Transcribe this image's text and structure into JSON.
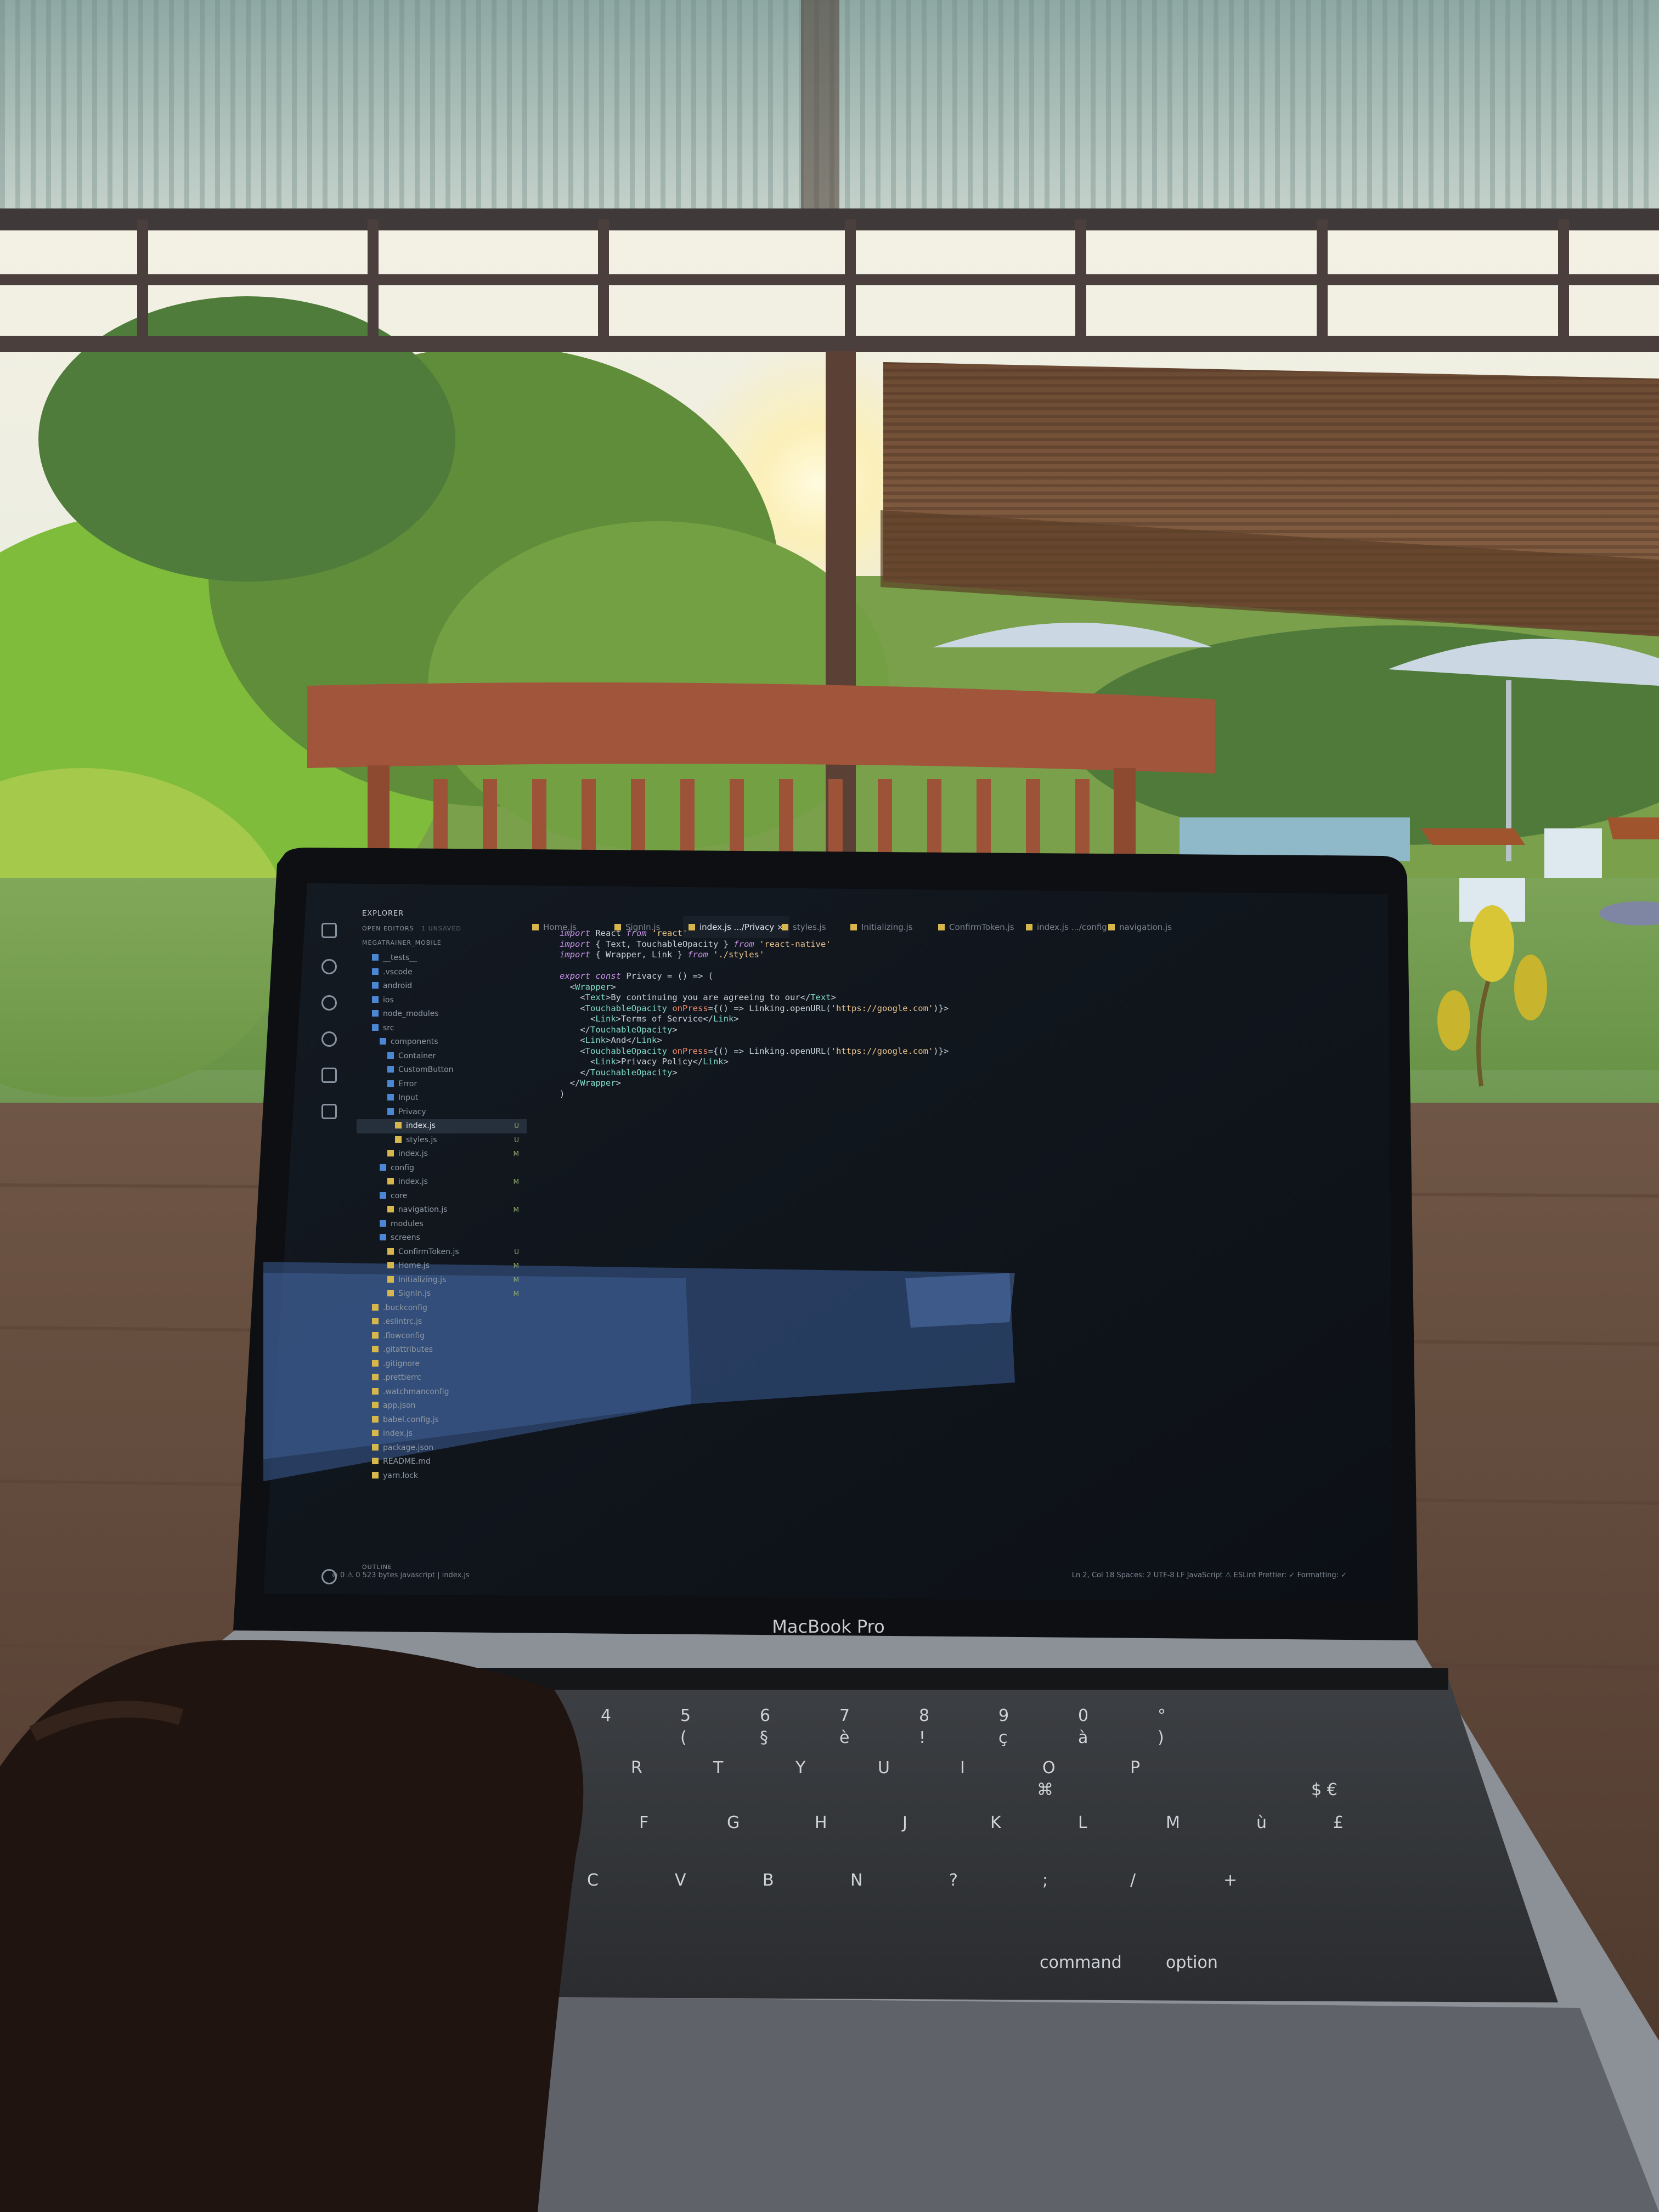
{
  "screen": {
    "explorer": {
      "title": "EXPLORER",
      "open_editors": "OPEN EDITORS",
      "open_editors_badge": "1 UNSAVED",
      "project": "MEGATRAINER_MOBILE",
      "outline": "OUTLINE",
      "tree": [
        {
          "label": "__tests__",
          "kind": "folder",
          "indent": 2
        },
        {
          "label": ".vscode",
          "kind": "folder",
          "indent": 2
        },
        {
          "label": "android",
          "kind": "folder",
          "indent": 2
        },
        {
          "label": "ios",
          "kind": "folder",
          "indent": 2
        },
        {
          "label": "node_modules",
          "kind": "folder",
          "indent": 2
        },
        {
          "label": "src",
          "kind": "folder",
          "indent": 2
        },
        {
          "label": "components",
          "kind": "folder",
          "indent": 3
        },
        {
          "label": "Container",
          "kind": "folder",
          "indent": 4
        },
        {
          "label": "CustomButton",
          "kind": "folder",
          "indent": 4
        },
        {
          "label": "Error",
          "kind": "folder",
          "indent": 4
        },
        {
          "label": "Input",
          "kind": "folder",
          "indent": 4
        },
        {
          "label": "Privacy",
          "kind": "folder",
          "indent": 4
        },
        {
          "label": "index.js",
          "kind": "file",
          "indent": 5,
          "status": "U",
          "active": true
        },
        {
          "label": "styles.js",
          "kind": "file",
          "indent": 5,
          "status": "U"
        },
        {
          "label": "index.js",
          "kind": "file",
          "indent": 4,
          "status": "M"
        },
        {
          "label": "config",
          "kind": "folder",
          "indent": 3
        },
        {
          "label": "index.js",
          "kind": "file",
          "indent": 4,
          "status": "M"
        },
        {
          "label": "core",
          "kind": "folder",
          "indent": 3
        },
        {
          "label": "navigation.js",
          "kind": "file",
          "indent": 4,
          "status": "M"
        },
        {
          "label": "modules",
          "kind": "folder",
          "indent": 3
        },
        {
          "label": "screens",
          "kind": "folder",
          "indent": 3
        },
        {
          "label": "ConfirmToken.js",
          "kind": "file",
          "indent": 4,
          "status": "U"
        },
        {
          "label": "Home.js",
          "kind": "file",
          "indent": 4,
          "status": "M"
        },
        {
          "label": "Initializing.js",
          "kind": "file",
          "indent": 4,
          "status": "M"
        },
        {
          "label": "SignIn.js",
          "kind": "file",
          "indent": 4,
          "status": "M"
        },
        {
          "label": ".buckconfig",
          "kind": "file",
          "indent": 2
        },
        {
          "label": ".eslintrc.js",
          "kind": "file",
          "indent": 2
        },
        {
          "label": ".flowconfig",
          "kind": "file",
          "indent": 2
        },
        {
          "label": ".gitattributes",
          "kind": "file",
          "indent": 2
        },
        {
          "label": ".gitignore",
          "kind": "file",
          "indent": 2
        },
        {
          "label": ".prettierrc",
          "kind": "file",
          "indent": 2
        },
        {
          "label": ".watchmanconfig",
          "kind": "file",
          "indent": 2
        },
        {
          "label": "app.json",
          "kind": "file",
          "indent": 2
        },
        {
          "label": "babel.config.js",
          "kind": "file",
          "indent": 2
        },
        {
          "label": "index.js",
          "kind": "file",
          "indent": 2
        },
        {
          "label": "package.json",
          "kind": "file",
          "indent": 2
        },
        {
          "label": "README.md",
          "kind": "file",
          "indent": 2
        },
        {
          "label": "yarn.lock",
          "kind": "file",
          "indent": 2
        }
      ]
    },
    "tabs": [
      {
        "label": "Home.js",
        "active": false
      },
      {
        "label": "SignIn.js",
        "active": false
      },
      {
        "label": "index.js  .../Privacy  ×",
        "active": true
      },
      {
        "label": "styles.js",
        "active": false
      },
      {
        "label": "Initializing.js",
        "active": false
      },
      {
        "label": "ConfirmToken.js",
        "active": false
      },
      {
        "label": "index.js  .../config",
        "active": false
      },
      {
        "label": "navigation.js",
        "active": false
      }
    ],
    "code": [
      "import React from 'react'",
      "import { Text, TouchableOpacity } from 'react-native'",
      "import { Wrapper, Link } from './styles'",
      "",
      "export const Privacy = () => (",
      "  <Wrapper>",
      "    <Text>By continuing you are agreeing to our</Text>",
      "    <TouchableOpacity onPress={() => Linking.openURL('https://google.com')}>",
      "      <Link>Terms of Service</Link>",
      "    </TouchableOpacity>",
      "    <Link>And</Link>",
      "    <TouchableOpacity onPress={() => Linking.openURL('https://google.com')}>",
      "      <Link>Privacy Policy</Link>",
      "    </TouchableOpacity>",
      "  </Wrapper>",
      ")"
    ],
    "status_left": "⊗ 0 ⚠ 0   523 bytes   javascript | index.js",
    "status_right": "Ln 2, Col 18   Spaces: 2   UTF-8   LF   JavaScript   ⚠ ESLint   Prettier: ✓   Formatting: ✓"
  },
  "laptop_brand": "MacBook Pro",
  "keyboard": {
    "number_row": [
      "4",
      "5",
      "6",
      "7",
      "8",
      "9",
      "0",
      "°"
    ],
    "number_row_shift": [
      "",
      "(",
      "§",
      "è",
      "!",
      "ç",
      "à",
      ")"
    ],
    "row2": [
      "R",
      "T",
      "Y",
      "U",
      "I",
      "O",
      "P"
    ],
    "row3": [
      "F",
      "G",
      "H",
      "J",
      "K",
      "L",
      "M",
      "ù",
      "£"
    ],
    "row4": [
      "C",
      "V",
      "B",
      "N",
      "?",
      ";",
      "/",
      "+"
    ],
    "bottom": [
      "command",
      "option"
    ],
    "extra": [
      "$ €",
      "⌘"
    ]
  },
  "colors": {
    "editor_bg": "#11161d",
    "accent_file": "#d7b64b",
    "accent_folder": "#4c87d6"
  }
}
